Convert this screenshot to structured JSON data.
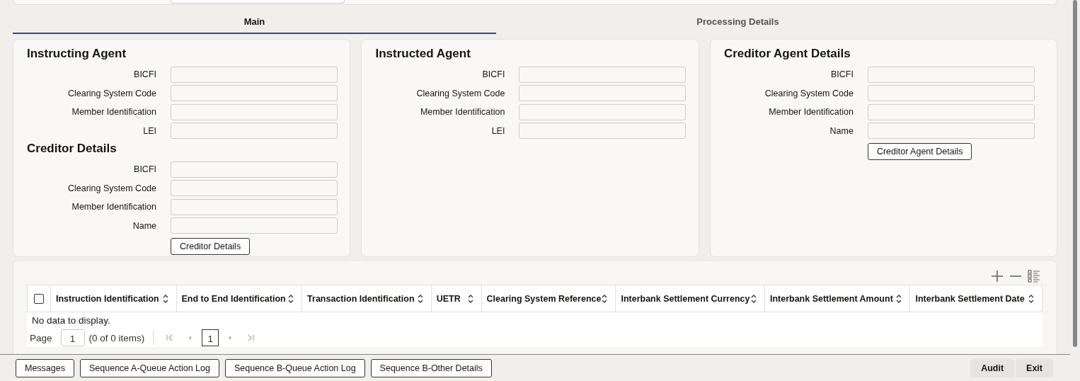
{
  "tabs": [
    {
      "label": "Main",
      "selected": true
    },
    {
      "label": "Processing Details",
      "selected": false
    }
  ],
  "panels": [
    {
      "sections": [
        {
          "title": "Instructing Agent",
          "fields": [
            {
              "label": "BICFI"
            },
            {
              "label": "Clearing System Code"
            },
            {
              "label": "Member Identification"
            },
            {
              "label": "LEI"
            }
          ]
        },
        {
          "title": "Creditor Details",
          "fields": [
            {
              "label": "BICFI"
            },
            {
              "label": "Clearing System Code"
            },
            {
              "label": "Member Identification"
            },
            {
              "label": "Name"
            }
          ],
          "button": "Creditor Details"
        }
      ]
    },
    {
      "sections": [
        {
          "title": "Instructed Agent",
          "fields": [
            {
              "label": "BICFI"
            },
            {
              "label": "Clearing System Code"
            },
            {
              "label": "Member Identification"
            },
            {
              "label": "LEI"
            }
          ]
        }
      ]
    },
    {
      "sections": [
        {
          "title": "Creditor Agent Details",
          "fields": [
            {
              "label": "BICFI"
            },
            {
              "label": "Clearing System Code"
            },
            {
              "label": "Member Identification"
            },
            {
              "label": "Name"
            }
          ],
          "button": "Creditor Agent Details"
        }
      ]
    }
  ],
  "table": {
    "select_all": {
      "checked": false
    },
    "columns": [
      "Instruction Identification",
      "End to End Identification",
      "Transaction Identification",
      "UETR",
      "Clearing System Reference",
      "Interbank Settlement Currency",
      "Interbank Settlement Amount",
      "Interbank Settlement Date"
    ],
    "empty_text": "No data to display.",
    "pager": {
      "label": "Page",
      "page": "1",
      "count": "(0 of 0 items)",
      "current": "1"
    }
  },
  "footer": {
    "left_buttons": [
      "Messages",
      "Sequence A-Queue Action Log",
      "Sequence B-Queue Action Log",
      "Sequence B-Other Details"
    ],
    "right_buttons": [
      "Audit",
      "Exit"
    ]
  }
}
